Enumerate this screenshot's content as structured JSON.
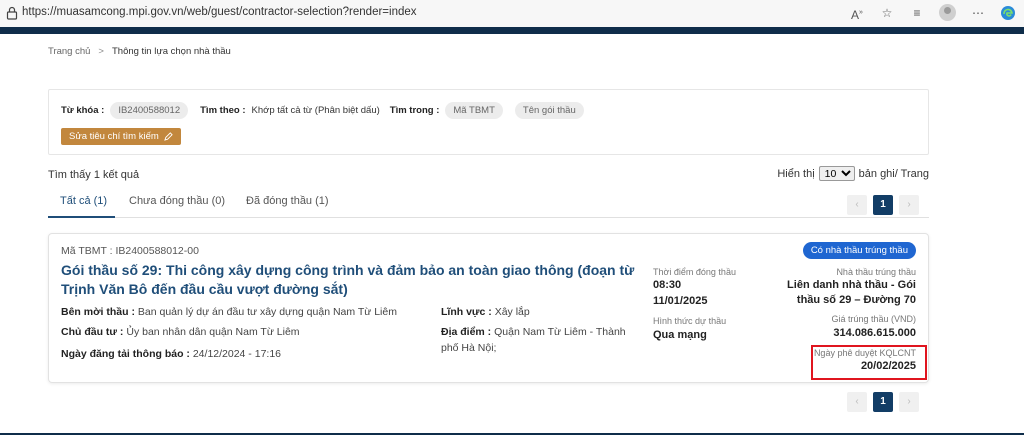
{
  "browser": {
    "url": "https://muasamcong.mpi.gov.vn/web/guest/contractor-selection?render=index",
    "icons": [
      "lock-icon",
      "read-aloud-icon",
      "favorite-icon",
      "favorites-list-icon",
      "profile-avatar",
      "more-icon",
      "edge-icon"
    ]
  },
  "breadcrumb": {
    "home": "Trang chủ",
    "separator": ">",
    "current": "Thông tin lựa chọn nhà thầu"
  },
  "criteria": {
    "keyword_label": "Từ khóa :",
    "keyword_value": "IB2400588012",
    "search_by_label": "Tìm theo :",
    "search_by_value": "Khớp tất cả từ (Phân biệt dấu)",
    "search_in_label": "Tìm trong :",
    "search_in_chips": [
      "Mã TBMT",
      "Tên gói thầu"
    ],
    "edit_button": "Sửa tiêu chí tìm kiếm"
  },
  "results": {
    "found_text": "Tìm thấy 1 kết quả",
    "show_label": "Hiển thị",
    "per_page_value": "10",
    "per_page_suffix": "bản ghi/ Trang",
    "tabs": [
      {
        "label": "Tất cả (1)",
        "active": true
      },
      {
        "label": "Chưa đóng thầu (0)",
        "active": false
      },
      {
        "label": "Đã đóng thầu (1)",
        "active": false
      }
    ],
    "pager": {
      "prev": "‹",
      "current": "1",
      "next": "›"
    }
  },
  "card": {
    "code": "Mã TBMT : IB2400588012-00",
    "title": "Gói thầu số 29: Thi công xây dựng công trình và đảm bảo an toàn giao thông (đoạn từ Trịnh Văn Bô đến đầu cầu vượt đường sắt)",
    "inviter_label": "Bên mời thầu :",
    "inviter_value": "Ban quản lý dự án đầu tư xây dựng quận Nam Từ Liêm",
    "investor_label": "Chủ đầu tư :",
    "investor_value": "Ủy ban nhân dân quận Nam Từ Liêm",
    "posted_label": "Ngày đăng tải thông báo :",
    "posted_value": "24/12/2024 - 17:16",
    "field_label": "Lĩnh vực :",
    "field_value": "Xây lắp",
    "location_label": "Địa điểm :",
    "location_value": "Quận Nam Từ Liêm - Thành phố Hà Nội;",
    "closing_label": "Thời điểm đóng thầu",
    "closing_time": "08:30",
    "closing_date": "11/01/2025",
    "form_label": "Hình thức dự thầu",
    "form_value": "Qua mạng",
    "badge": "Có nhà thầu trúng thầu",
    "winner_label": "Nhà thầu trúng thầu",
    "winner_value": "Liên danh nhà thầu - Gói thầu số 29 – Đường 70",
    "price_label": "Giá trúng thầu (VND)",
    "price_value": "314.086.615.000",
    "approval_label": "Ngày phê duyệt KQLCNT",
    "approval_value": "20/02/2025"
  },
  "colors": {
    "brand_navy": "#0f2d4a",
    "title_blue": "#1f4e79",
    "badge_blue": "#1f66d1",
    "edit_button": "#c2873d",
    "highlight_red": "#e0151f"
  }
}
